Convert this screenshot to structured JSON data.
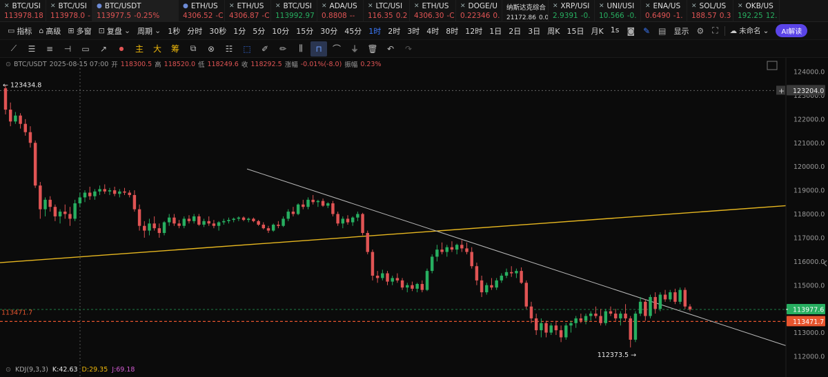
{
  "tickers": [
    {
      "symbol": "BTC/USI",
      "value": "113978.18",
      "change": "",
      "dir": "down",
      "icon": "close-icon"
    },
    {
      "symbol": "BTC/USI",
      "value": "113978.0",
      "change": "-",
      "dir": "down",
      "icon": "close-icon"
    },
    {
      "symbol": "BTC/USDT",
      "value": "113977.5",
      "change": "-0.25%",
      "dir": "down",
      "icon": "coin-icon",
      "active": true
    },
    {
      "symbol": "ETH/US",
      "value": "4306.52",
      "change": "-C",
      "dir": "down",
      "icon": "coin-icon"
    },
    {
      "symbol": "ETH/US",
      "value": "4306.87",
      "change": "-C",
      "dir": "down",
      "icon": "close-icon"
    },
    {
      "symbol": "BTC/USI",
      "value": "113992.97",
      "change": "",
      "dir": "up",
      "icon": "close-icon"
    },
    {
      "symbol": "ADA/US",
      "value": "0.8808",
      "change": "--",
      "dir": "down",
      "icon": "close-icon"
    },
    {
      "symbol": "LTC/USI",
      "value": "116.35",
      "change": "0.2",
      "dir": "down",
      "icon": "close-icon"
    },
    {
      "symbol": "ETH/US",
      "value": "4306.30",
      "change": "-C",
      "dir": "down",
      "icon": "close-icon"
    },
    {
      "symbol": "DOGE/U",
      "value": "0.22346",
      "change": "0.",
      "dir": "down",
      "icon": "close-icon"
    },
    {
      "symbol": "纳斯达克综合",
      "value": "21172.86",
      "change": "0.00",
      "dir": "neutral",
      "icon": ""
    },
    {
      "symbol": "XRP/USI",
      "value": "2.9391",
      "change": "-0.",
      "dir": "up",
      "icon": "close-icon"
    },
    {
      "symbol": "UNI/USI",
      "value": "10.566",
      "change": "-0.",
      "dir": "up",
      "icon": "close-icon"
    },
    {
      "symbol": "ENA/US",
      "value": "0.6490",
      "change": "-1.",
      "dir": "down",
      "icon": "close-icon"
    },
    {
      "symbol": "SOL/US",
      "value": "188.57",
      "change": "0.3",
      "dir": "down",
      "icon": "close-icon"
    },
    {
      "symbol": "OKB/US",
      "value": "192.25",
      "change": "12.",
      "dir": "up",
      "icon": "close-icon"
    }
  ],
  "toolbar": {
    "indicators": "指标",
    "advanced": "高级",
    "multi_window": "多窗",
    "replay": "复盘",
    "period": "周期",
    "intervals": [
      "1秒",
      "分时",
      "30秒",
      "1分",
      "5分",
      "10分",
      "15分",
      "30分",
      "45分",
      "1时",
      "2时",
      "3时",
      "4时",
      "8时",
      "12时",
      "1日",
      "2日",
      "3日",
      "周K",
      "15日",
      "月K",
      "1s"
    ],
    "active_interval": "1时",
    "display": "显示",
    "unnamed": "未命名",
    "ai_label": "AI解读"
  },
  "drawbar": {
    "chars": [
      "主",
      "大",
      "筹"
    ]
  },
  "ohlc": {
    "symbol": "BTC/USDT",
    "datetime": "2025-08-15 07:00",
    "open_label": "开",
    "open": "118300.5",
    "high_label": "高",
    "high": "118520.0",
    "low_label": "低",
    "low": "118249.6",
    "close_label": "收",
    "close": "118292.5",
    "change_label": "涨幅",
    "change": "-0.01%(-8.0)",
    "amplitude_label": "振幅",
    "amplitude": "0.23%"
  },
  "kdj": {
    "label": "KDJ(9,3,3)",
    "k": "K:42.63",
    "d": "D:29.35",
    "j": "J:69.18"
  },
  "price_tags": {
    "high_mark": "← 123434.8",
    "low_mark": "112373.5 →",
    "crosshair_price": "123204.0",
    "last_price": "113977.6",
    "alert_price": "113471.7",
    "alert_left": "113471.7"
  },
  "colors": {
    "up": "#27ae60",
    "down": "#e05454",
    "accent": "#3d7bff",
    "trendline_yellow": "#e8b820",
    "trendline_white": "#bbbbbb"
  },
  "chart_data": {
    "type": "candlestick",
    "symbol": "BTC/USDT",
    "interval": "1h",
    "yticks": [
      124000,
      123000,
      122000,
      121000,
      120000,
      119000,
      118000,
      117000,
      116000,
      115000,
      114000,
      113000,
      112000
    ],
    "ylim": [
      111600,
      124400
    ],
    "candles": [
      {
        "o": 123300,
        "h": 123434.8,
        "l": 122200,
        "c": 122400
      },
      {
        "o": 122400,
        "h": 122700,
        "l": 121700,
        "c": 121900
      },
      {
        "o": 121900,
        "h": 122300,
        "l": 121800,
        "c": 122150
      },
      {
        "o": 122150,
        "h": 122250,
        "l": 121600,
        "c": 121800
      },
      {
        "o": 121800,
        "h": 122000,
        "l": 121300,
        "c": 121450
      },
      {
        "o": 121450,
        "h": 121700,
        "l": 120800,
        "c": 121000
      },
      {
        "o": 121000,
        "h": 121100,
        "l": 119100,
        "c": 119200
      },
      {
        "o": 119200,
        "h": 119350,
        "l": 117800,
        "c": 118200
      },
      {
        "o": 118200,
        "h": 118700,
        "l": 117900,
        "c": 118600
      },
      {
        "o": 118600,
        "h": 118750,
        "l": 118100,
        "c": 118300
      },
      {
        "o": 118300,
        "h": 118400,
        "l": 117700,
        "c": 117900
      },
      {
        "o": 117900,
        "h": 118200,
        "l": 117600,
        "c": 118100
      },
      {
        "o": 118100,
        "h": 118400,
        "l": 117800,
        "c": 118000
      },
      {
        "o": 118000,
        "h": 118300,
        "l": 117500,
        "c": 117800
      },
      {
        "o": 117800,
        "h": 118600,
        "l": 117700,
        "c": 118450
      },
      {
        "o": 118450,
        "h": 118900,
        "l": 118300,
        "c": 118700
      },
      {
        "o": 118700,
        "h": 119000,
        "l": 118500,
        "c": 118900
      },
      {
        "o": 118900,
        "h": 119150,
        "l": 118600,
        "c": 118750
      },
      {
        "o": 118750,
        "h": 119050,
        "l": 118600,
        "c": 118950
      },
      {
        "o": 118950,
        "h": 119200,
        "l": 118800,
        "c": 119050
      },
      {
        "o": 119050,
        "h": 119250,
        "l": 118850,
        "c": 118950
      },
      {
        "o": 118950,
        "h": 119100,
        "l": 118800,
        "c": 119000
      },
      {
        "o": 119000,
        "h": 119150,
        "l": 118750,
        "c": 118850
      },
      {
        "o": 118850,
        "h": 119050,
        "l": 118700,
        "c": 118950
      },
      {
        "o": 118950,
        "h": 119100,
        "l": 118800,
        "c": 118900
      },
      {
        "o": 118900,
        "h": 119000,
        "l": 118700,
        "c": 118800
      },
      {
        "o": 118800,
        "h": 119000,
        "l": 118100,
        "c": 118200
      },
      {
        "o": 118200,
        "h": 118400,
        "l": 117300,
        "c": 117500
      },
      {
        "o": 117500,
        "h": 117700,
        "l": 117000,
        "c": 117300
      },
      {
        "o": 117300,
        "h": 117800,
        "l": 117100,
        "c": 117600
      },
      {
        "o": 117600,
        "h": 117900,
        "l": 117300,
        "c": 117400
      },
      {
        "o": 117400,
        "h": 117600,
        "l": 117000,
        "c": 117200
      },
      {
        "o": 117200,
        "h": 117700,
        "l": 117100,
        "c": 117650
      },
      {
        "o": 117650,
        "h": 118000,
        "l": 117500,
        "c": 117850
      },
      {
        "o": 117850,
        "h": 118000,
        "l": 117500,
        "c": 117600
      },
      {
        "o": 117600,
        "h": 117750,
        "l": 117400,
        "c": 117500
      },
      {
        "o": 117500,
        "h": 117900,
        "l": 117400,
        "c": 117800
      },
      {
        "o": 117800,
        "h": 117950,
        "l": 117600,
        "c": 117700
      },
      {
        "o": 117700,
        "h": 118000,
        "l": 117600,
        "c": 117900
      },
      {
        "o": 117900,
        "h": 118000,
        "l": 117500,
        "c": 117550
      },
      {
        "o": 117550,
        "h": 117800,
        "l": 117450,
        "c": 117700
      },
      {
        "o": 117700,
        "h": 117900,
        "l": 117500,
        "c": 117600
      },
      {
        "o": 117600,
        "h": 117750,
        "l": 117400,
        "c": 117500
      },
      {
        "o": 117500,
        "h": 117700,
        "l": 117300,
        "c": 117650
      },
      {
        "o": 117650,
        "h": 117800,
        "l": 117550,
        "c": 117700
      },
      {
        "o": 117700,
        "h": 117850,
        "l": 117600,
        "c": 117750
      },
      {
        "o": 117750,
        "h": 117850,
        "l": 117650,
        "c": 117800
      },
      {
        "o": 117800,
        "h": 117900,
        "l": 117700,
        "c": 117850
      },
      {
        "o": 117850,
        "h": 117900,
        "l": 117700,
        "c": 117750
      },
      {
        "o": 117750,
        "h": 117850,
        "l": 117650,
        "c": 117800
      },
      {
        "o": 117800,
        "h": 117850,
        "l": 117650,
        "c": 117700
      },
      {
        "o": 117700,
        "h": 117750,
        "l": 117500,
        "c": 117550
      },
      {
        "o": 117550,
        "h": 117650,
        "l": 117350,
        "c": 117400
      },
      {
        "o": 117400,
        "h": 117500,
        "l": 117200,
        "c": 117300
      },
      {
        "o": 117300,
        "h": 117600,
        "l": 117250,
        "c": 117550
      },
      {
        "o": 117550,
        "h": 117700,
        "l": 117400,
        "c": 117500
      },
      {
        "o": 117500,
        "h": 117900,
        "l": 117450,
        "c": 117800
      },
      {
        "o": 117800,
        "h": 118200,
        "l": 117700,
        "c": 118100
      },
      {
        "o": 118100,
        "h": 118300,
        "l": 117900,
        "c": 118000
      },
      {
        "o": 118000,
        "h": 118450,
        "l": 117950,
        "c": 118400
      },
      {
        "o": 118400,
        "h": 118600,
        "l": 118200,
        "c": 118300
      },
      {
        "o": 118300,
        "h": 118700,
        "l": 118200,
        "c": 118600
      },
      {
        "o": 118600,
        "h": 118800,
        "l": 118400,
        "c": 118500
      },
      {
        "o": 118500,
        "h": 118600,
        "l": 118300,
        "c": 118550
      },
      {
        "o": 118550,
        "h": 118650,
        "l": 118300,
        "c": 118350
      },
      {
        "o": 118350,
        "h": 118500,
        "l": 118250,
        "c": 118450
      },
      {
        "o": 118450,
        "h": 118550,
        "l": 117900,
        "c": 118000
      },
      {
        "o": 118000,
        "h": 118100,
        "l": 117500,
        "c": 117600
      },
      {
        "o": 117600,
        "h": 117900,
        "l": 117400,
        "c": 117800
      },
      {
        "o": 117800,
        "h": 117950,
        "l": 117550,
        "c": 117650
      },
      {
        "o": 117650,
        "h": 117900,
        "l": 117500,
        "c": 117850
      },
      {
        "o": 117850,
        "h": 118100,
        "l": 117700,
        "c": 118000
      },
      {
        "o": 118000,
        "h": 118050,
        "l": 117100,
        "c": 117200
      },
      {
        "o": 117200,
        "h": 117300,
        "l": 116300,
        "c": 116400
      },
      {
        "o": 116400,
        "h": 116500,
        "l": 115200,
        "c": 115400
      },
      {
        "o": 115400,
        "h": 115600,
        "l": 115100,
        "c": 115300
      },
      {
        "o": 115300,
        "h": 115650,
        "l": 115200,
        "c": 115500
      },
      {
        "o": 115500,
        "h": 115600,
        "l": 115000,
        "c": 115150
      },
      {
        "o": 115150,
        "h": 115400,
        "l": 115000,
        "c": 115300
      },
      {
        "o": 115300,
        "h": 115500,
        "l": 115100,
        "c": 115200
      },
      {
        "o": 115200,
        "h": 115300,
        "l": 114800,
        "c": 114900
      },
      {
        "o": 114900,
        "h": 115100,
        "l": 114700,
        "c": 115000
      },
      {
        "o": 115000,
        "h": 115150,
        "l": 114750,
        "c": 114850
      },
      {
        "o": 114850,
        "h": 115100,
        "l": 114700,
        "c": 115050
      },
      {
        "o": 115050,
        "h": 115200,
        "l": 114700,
        "c": 114800
      },
      {
        "o": 114800,
        "h": 115700,
        "l": 114750,
        "c": 115600
      },
      {
        "o": 115600,
        "h": 116300,
        "l": 115500,
        "c": 116200
      },
      {
        "o": 116200,
        "h": 116700,
        "l": 116000,
        "c": 116500
      },
      {
        "o": 116500,
        "h": 116800,
        "l": 116300,
        "c": 116400
      },
      {
        "o": 116400,
        "h": 116700,
        "l": 116200,
        "c": 116600
      },
      {
        "o": 116600,
        "h": 116850,
        "l": 116400,
        "c": 116500
      },
      {
        "o": 116500,
        "h": 116750,
        "l": 116300,
        "c": 116700
      },
      {
        "o": 116700,
        "h": 116900,
        "l": 116400,
        "c": 116550
      },
      {
        "o": 116550,
        "h": 116800,
        "l": 116300,
        "c": 116400
      },
      {
        "o": 116400,
        "h": 116600,
        "l": 115700,
        "c": 115800
      },
      {
        "o": 115800,
        "h": 115950,
        "l": 115000,
        "c": 115200
      },
      {
        "o": 115200,
        "h": 115400,
        "l": 114500,
        "c": 114700
      },
      {
        "o": 114700,
        "h": 115100,
        "l": 114600,
        "c": 115000
      },
      {
        "o": 115000,
        "h": 115300,
        "l": 114800,
        "c": 114900
      },
      {
        "o": 114900,
        "h": 115300,
        "l": 114800,
        "c": 115200
      },
      {
        "o": 115200,
        "h": 115500,
        "l": 115100,
        "c": 115400
      },
      {
        "o": 115400,
        "h": 115700,
        "l": 115300,
        "c": 115550
      },
      {
        "o": 115550,
        "h": 115800,
        "l": 115350,
        "c": 115500
      },
      {
        "o": 115500,
        "h": 115700,
        "l": 115300,
        "c": 115600
      },
      {
        "o": 115600,
        "h": 115750,
        "l": 115050,
        "c": 115100
      },
      {
        "o": 115100,
        "h": 115200,
        "l": 114000,
        "c": 114100
      },
      {
        "o": 114100,
        "h": 114300,
        "l": 113400,
        "c": 113600
      },
      {
        "o": 113600,
        "h": 113800,
        "l": 112900,
        "c": 113100
      },
      {
        "o": 113100,
        "h": 113600,
        "l": 112800,
        "c": 113400
      },
      {
        "o": 113400,
        "h": 113500,
        "l": 112800,
        "c": 113000
      },
      {
        "o": 113000,
        "h": 113400,
        "l": 112900,
        "c": 113300
      },
      {
        "o": 113300,
        "h": 113500,
        "l": 112900,
        "c": 113100
      },
      {
        "o": 113100,
        "h": 113300,
        "l": 112600,
        "c": 112800
      },
      {
        "o": 112800,
        "h": 113400,
        "l": 112700,
        "c": 113300
      },
      {
        "o": 113300,
        "h": 113500,
        "l": 113000,
        "c": 113400
      },
      {
        "o": 113400,
        "h": 113700,
        "l": 113200,
        "c": 113600
      },
      {
        "o": 113600,
        "h": 113800,
        "l": 113400,
        "c": 113500
      },
      {
        "o": 113500,
        "h": 113800,
        "l": 113350,
        "c": 113700
      },
      {
        "o": 113700,
        "h": 113900,
        "l": 113500,
        "c": 113800
      },
      {
        "o": 113800,
        "h": 114100,
        "l": 113600,
        "c": 113700
      },
      {
        "o": 113700,
        "h": 114000,
        "l": 113300,
        "c": 113400
      },
      {
        "o": 113400,
        "h": 114000,
        "l": 113300,
        "c": 113900
      },
      {
        "o": 113900,
        "h": 114100,
        "l": 113700,
        "c": 113800
      },
      {
        "o": 113800,
        "h": 114000,
        "l": 113500,
        "c": 113600
      },
      {
        "o": 113600,
        "h": 113900,
        "l": 113300,
        "c": 113800
      },
      {
        "o": 113800,
        "h": 114200,
        "l": 113500,
        "c": 113600
      },
      {
        "o": 113600,
        "h": 113700,
        "l": 112373.5,
        "c": 112700
      },
      {
        "o": 112700,
        "h": 113900,
        "l": 112600,
        "c": 113800
      },
      {
        "o": 113800,
        "h": 114500,
        "l": 113700,
        "c": 114300
      },
      {
        "o": 114300,
        "h": 114400,
        "l": 113500,
        "c": 113700
      },
      {
        "o": 113700,
        "h": 114600,
        "l": 113600,
        "c": 114500
      },
      {
        "o": 114500,
        "h": 114700,
        "l": 113800,
        "c": 114000
      },
      {
        "o": 114000,
        "h": 114700,
        "l": 113900,
        "c": 114600
      },
      {
        "o": 114600,
        "h": 114800,
        "l": 114300,
        "c": 114400
      },
      {
        "o": 114400,
        "h": 114800,
        "l": 114300,
        "c": 114700
      },
      {
        "o": 114700,
        "h": 114850,
        "l": 114200,
        "c": 114300
      },
      {
        "o": 114300,
        "h": 114900,
        "l": 114200,
        "c": 114800
      },
      {
        "o": 114800,
        "h": 114900,
        "l": 114000,
        "c": 114100
      },
      {
        "o": 114100,
        "h": 114200,
        "l": 113900,
        "c": 113977.6
      }
    ]
  }
}
